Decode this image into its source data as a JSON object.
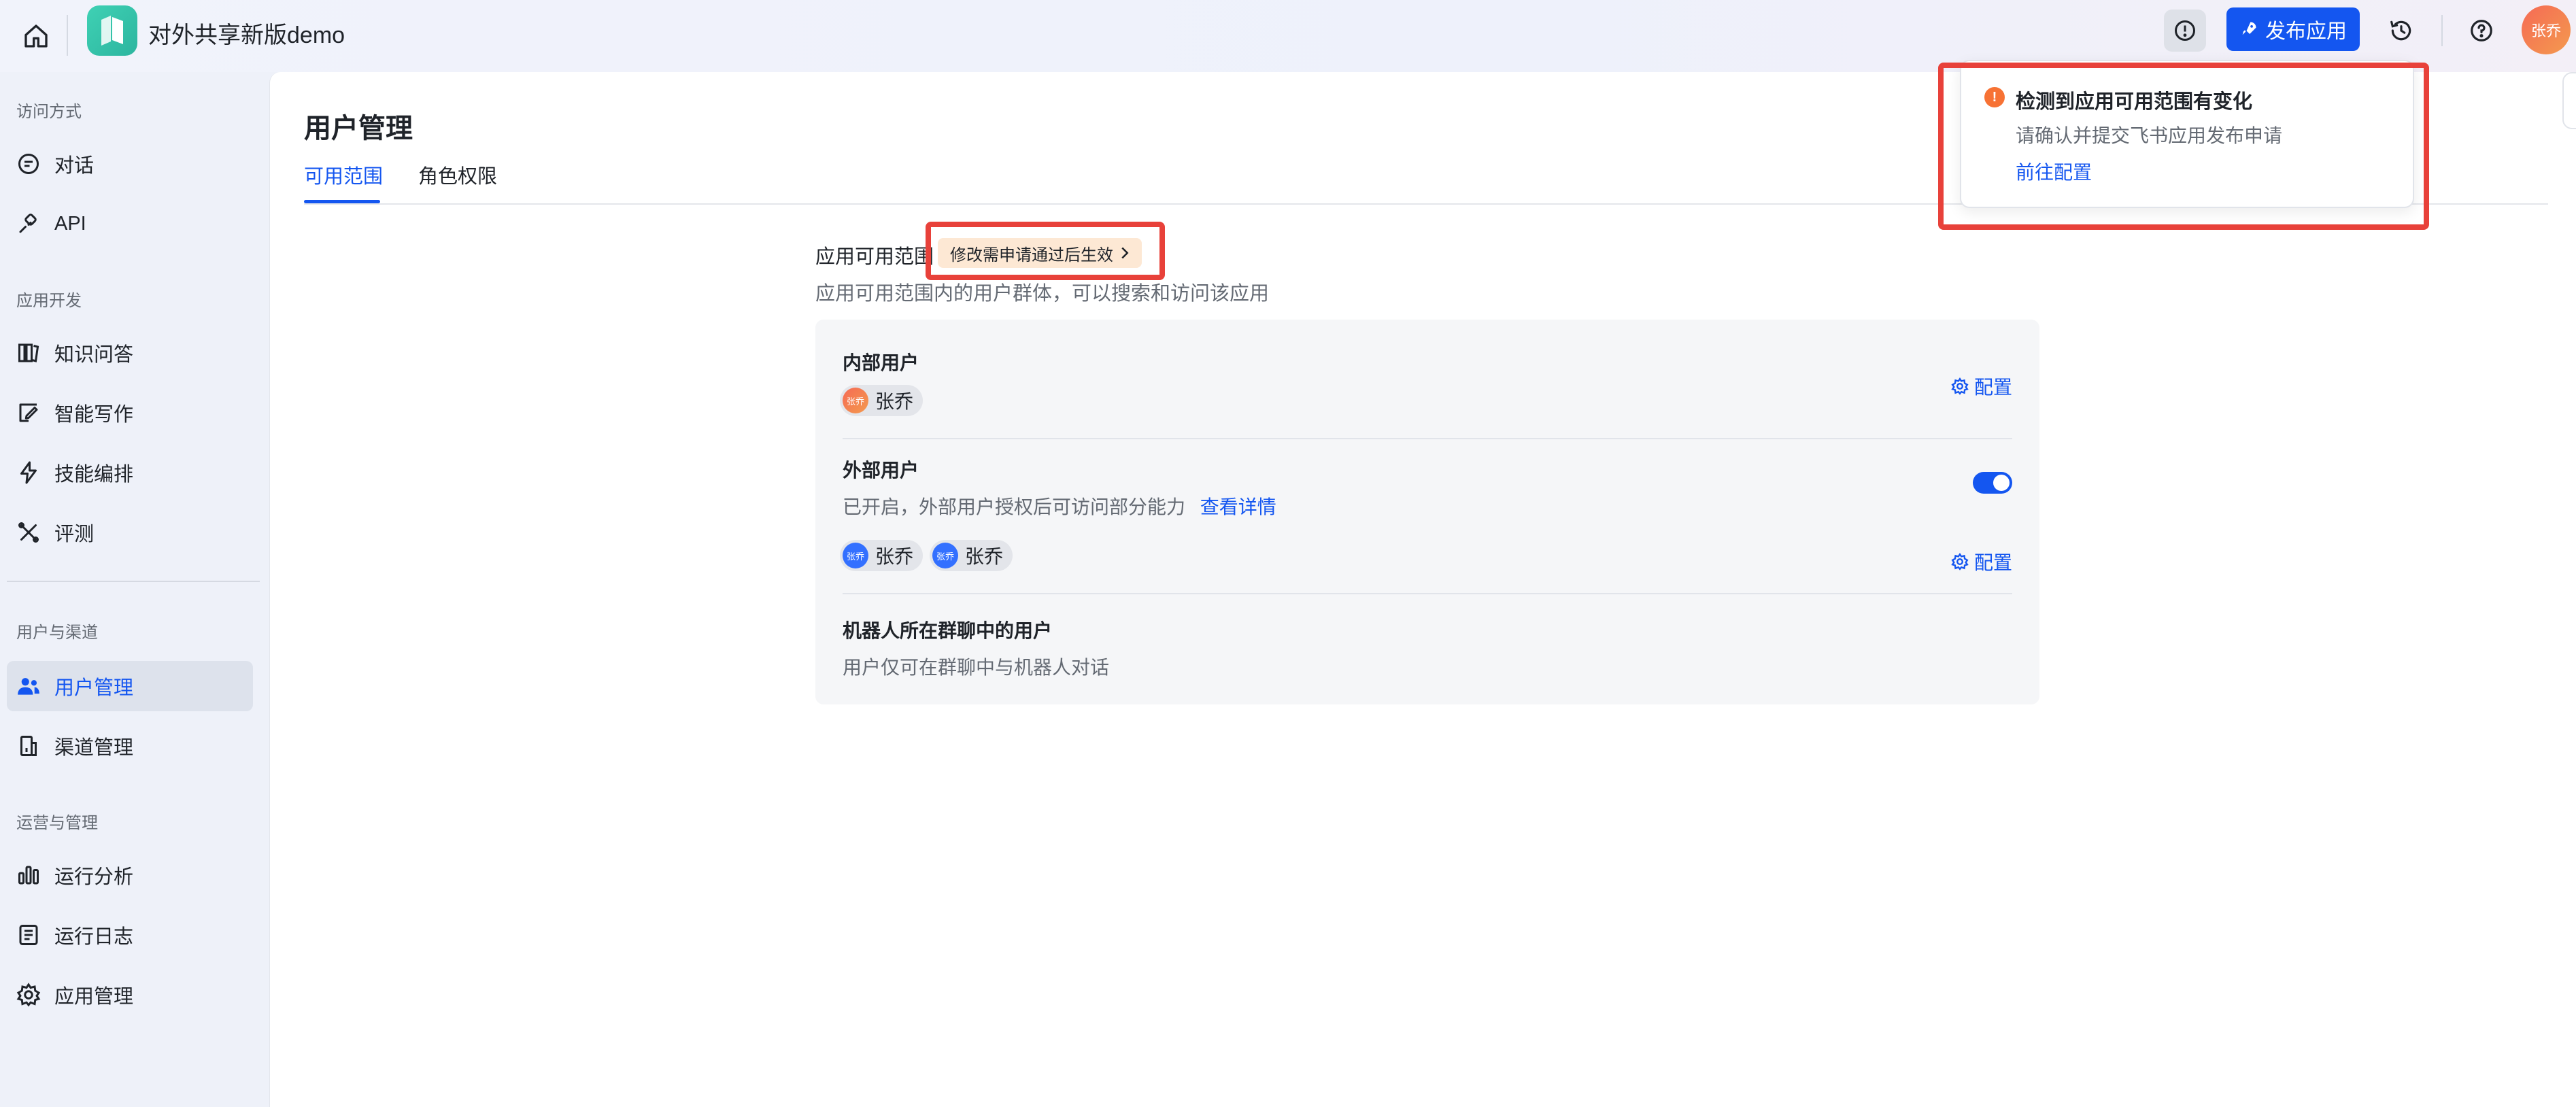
{
  "header": {
    "app_name": "对外共享新版demo",
    "publish_label": "发布应用",
    "user_avatar_text": "张乔"
  },
  "sidebar": {
    "groups": [
      {
        "title": "访问方式",
        "items": [
          {
            "label": "对话",
            "icon": "chat-bubble-icon"
          },
          {
            "label": "API",
            "icon": "api-plug-icon"
          }
        ]
      },
      {
        "title": "应用开发",
        "items": [
          {
            "label": "知识问答",
            "icon": "book-icon"
          },
          {
            "label": "智能写作",
            "icon": "pen-write-icon"
          },
          {
            "label": "技能编排",
            "icon": "lightning-icon"
          },
          {
            "label": "评测",
            "icon": "tools-icon"
          }
        ]
      },
      {
        "title": "用户与渠道",
        "items": [
          {
            "label": "用户管理",
            "icon": "users-icon",
            "active": true
          },
          {
            "label": "渠道管理",
            "icon": "channel-icon"
          }
        ]
      },
      {
        "title": "运营与管理",
        "items": [
          {
            "label": "运行分析",
            "icon": "bar-chart-icon"
          },
          {
            "label": "运行日志",
            "icon": "log-icon"
          },
          {
            "label": "应用管理",
            "icon": "gear-icon"
          }
        ]
      }
    ]
  },
  "main": {
    "title": "用户管理",
    "tabs": [
      {
        "label": "可用范围",
        "active": true
      },
      {
        "label": "角色权限",
        "active": false
      }
    ],
    "scope": {
      "label": "应用可用范围",
      "pending_tag": "修改需申请通过后生效",
      "description": "应用可用范围内的用户群体，可以搜索和访问该应用",
      "internal": {
        "title": "内部用户",
        "users": [
          "张乔"
        ],
        "config_label": "配置"
      },
      "external": {
        "title": "外部用户",
        "description": "已开启，外部用户授权后可访问部分能力",
        "detail_link": "查看详情",
        "enabled": true,
        "users": [
          "张乔",
          "张乔"
        ],
        "config_label": "配置"
      },
      "robot": {
        "title": "机器人所在群聊中的用户",
        "description": "用户仅可在群聊中与机器人对话"
      }
    }
  },
  "notification": {
    "title": "检测到应用可用范围有变化",
    "description": "请确认并提交飞书应用发布申请",
    "link": "前往配置"
  },
  "colors": {
    "accent": "#1456f0",
    "highlight": "#e8413a",
    "warning": "#f77234"
  }
}
